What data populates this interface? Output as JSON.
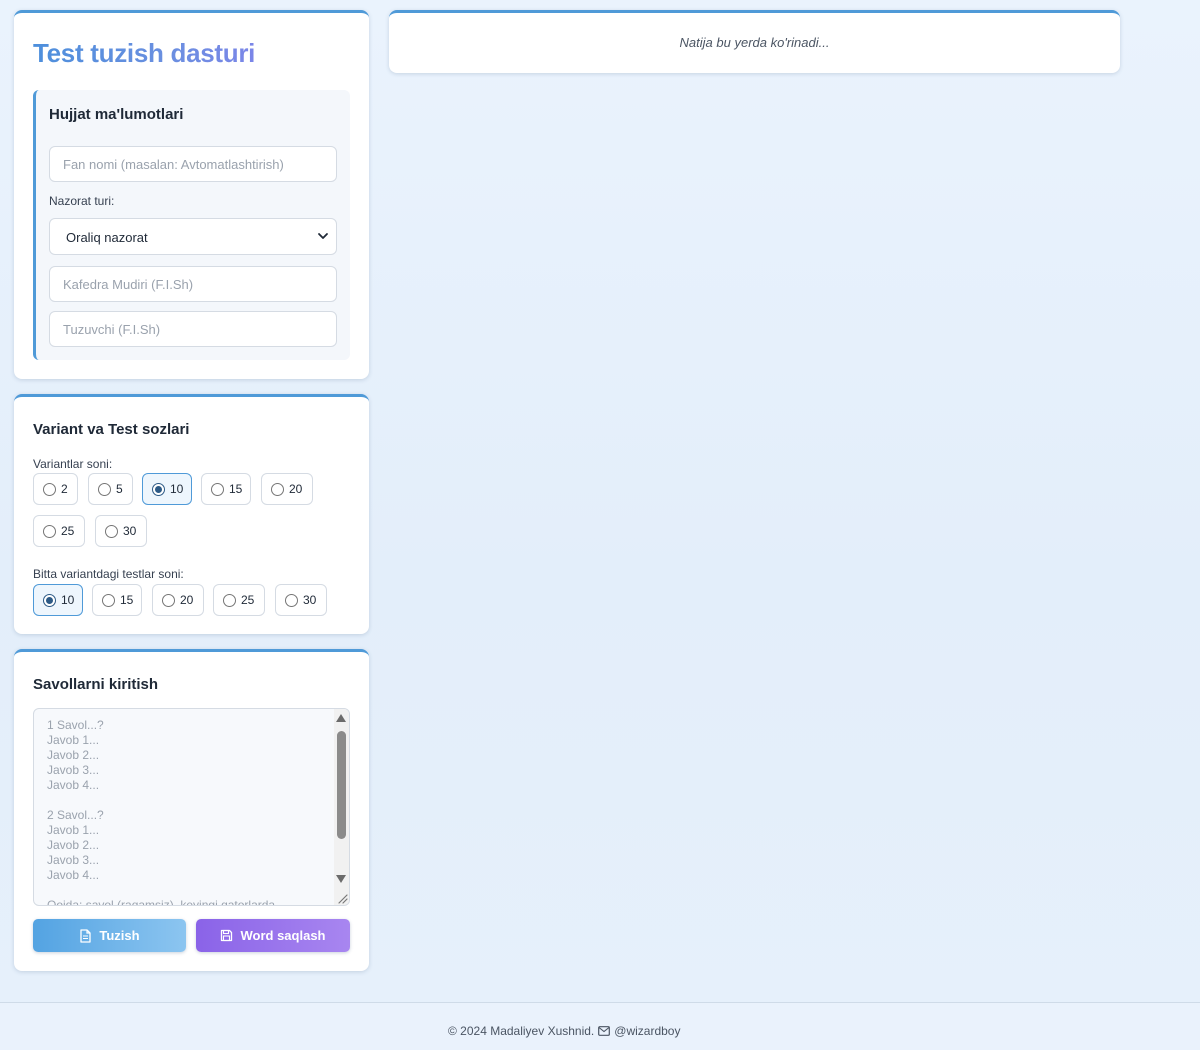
{
  "app": {
    "title": "Test tuzish dasturi"
  },
  "document_info": {
    "heading": "Hujjat ma'lumotlari",
    "subject_placeholder": "Fan nomi (masalan: Avtomatlashtirish)",
    "control_type_label": "Nazorat turi:",
    "control_type_value": "Oraliq nazorat",
    "head_of_dept_placeholder": "Kafedra Mudiri (F.I.Sh)",
    "author_placeholder": "Tuzuvchi (F.I.Sh)"
  },
  "variant_settings": {
    "heading": "Variant va Test sozlari",
    "variant_count_label": "Variantlar soni:",
    "variant_options": [
      "2",
      "5",
      "10",
      "15",
      "20",
      "25",
      "30"
    ],
    "variant_selected": "10",
    "tests_per_variant_label": "Bitta variantdagi testlar soni:",
    "test_options": [
      "10",
      "15",
      "20",
      "25",
      "30"
    ],
    "test_selected": "10"
  },
  "questions": {
    "heading": "Savollarni kiritish",
    "placeholder_lines": "1 Savol...?\nJavob 1...\nJavob 2...\nJavob 3...\nJavob 4...\n\n2 Savol...?\nJavob 1...\nJavob 2...\nJavob 3...\nJavob 4...\n\nQoida: savol (raqamsiz), keyingi qatorlarda",
    "build_button": "Tuzish",
    "save_button": "Word saqlash"
  },
  "result": {
    "placeholder": "Natija bu yerda ko'rinadi..."
  },
  "footer": {
    "copyright": "© 2024 Madaliyev Xushnid.",
    "contact": "@wizardboy"
  },
  "colors": {
    "accent_blue": "#4f9ad8",
    "accent_purple": "#8a63e8",
    "background": "#e6f0fb"
  }
}
